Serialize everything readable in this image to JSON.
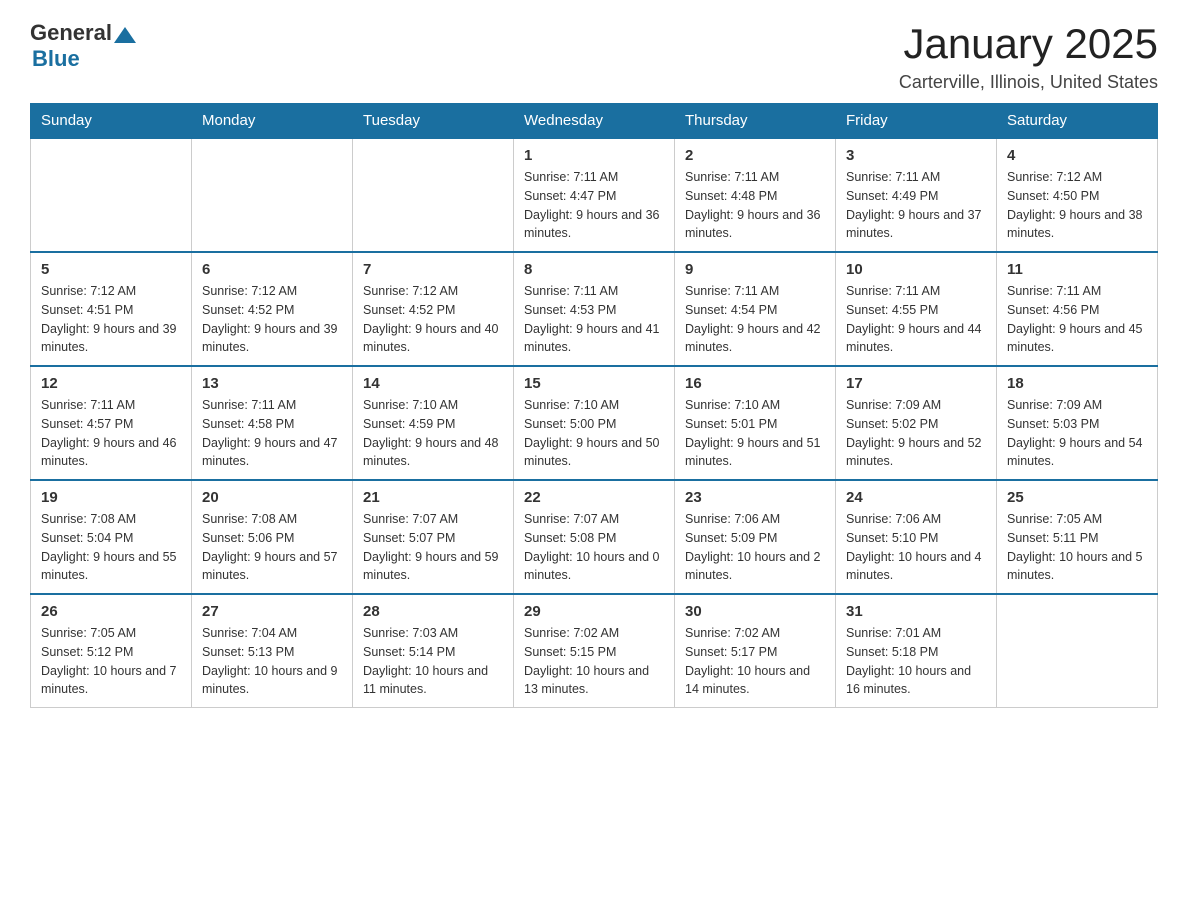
{
  "logo": {
    "text_general": "General",
    "triangle": "▲",
    "text_blue": "Blue"
  },
  "header": {
    "title": "January 2025",
    "subtitle": "Carterville, Illinois, United States"
  },
  "days_of_week": [
    "Sunday",
    "Monday",
    "Tuesday",
    "Wednesday",
    "Thursday",
    "Friday",
    "Saturday"
  ],
  "weeks": [
    [
      {
        "day": "",
        "info": ""
      },
      {
        "day": "",
        "info": ""
      },
      {
        "day": "",
        "info": ""
      },
      {
        "day": "1",
        "info": "Sunrise: 7:11 AM\nSunset: 4:47 PM\nDaylight: 9 hours and 36 minutes."
      },
      {
        "day": "2",
        "info": "Sunrise: 7:11 AM\nSunset: 4:48 PM\nDaylight: 9 hours and 36 minutes."
      },
      {
        "day": "3",
        "info": "Sunrise: 7:11 AM\nSunset: 4:49 PM\nDaylight: 9 hours and 37 minutes."
      },
      {
        "day": "4",
        "info": "Sunrise: 7:12 AM\nSunset: 4:50 PM\nDaylight: 9 hours and 38 minutes."
      }
    ],
    [
      {
        "day": "5",
        "info": "Sunrise: 7:12 AM\nSunset: 4:51 PM\nDaylight: 9 hours and 39 minutes."
      },
      {
        "day": "6",
        "info": "Sunrise: 7:12 AM\nSunset: 4:52 PM\nDaylight: 9 hours and 39 minutes."
      },
      {
        "day": "7",
        "info": "Sunrise: 7:12 AM\nSunset: 4:52 PM\nDaylight: 9 hours and 40 minutes."
      },
      {
        "day": "8",
        "info": "Sunrise: 7:11 AM\nSunset: 4:53 PM\nDaylight: 9 hours and 41 minutes."
      },
      {
        "day": "9",
        "info": "Sunrise: 7:11 AM\nSunset: 4:54 PM\nDaylight: 9 hours and 42 minutes."
      },
      {
        "day": "10",
        "info": "Sunrise: 7:11 AM\nSunset: 4:55 PM\nDaylight: 9 hours and 44 minutes."
      },
      {
        "day": "11",
        "info": "Sunrise: 7:11 AM\nSunset: 4:56 PM\nDaylight: 9 hours and 45 minutes."
      }
    ],
    [
      {
        "day": "12",
        "info": "Sunrise: 7:11 AM\nSunset: 4:57 PM\nDaylight: 9 hours and 46 minutes."
      },
      {
        "day": "13",
        "info": "Sunrise: 7:11 AM\nSunset: 4:58 PM\nDaylight: 9 hours and 47 minutes."
      },
      {
        "day": "14",
        "info": "Sunrise: 7:10 AM\nSunset: 4:59 PM\nDaylight: 9 hours and 48 minutes."
      },
      {
        "day": "15",
        "info": "Sunrise: 7:10 AM\nSunset: 5:00 PM\nDaylight: 9 hours and 50 minutes."
      },
      {
        "day": "16",
        "info": "Sunrise: 7:10 AM\nSunset: 5:01 PM\nDaylight: 9 hours and 51 minutes."
      },
      {
        "day": "17",
        "info": "Sunrise: 7:09 AM\nSunset: 5:02 PM\nDaylight: 9 hours and 52 minutes."
      },
      {
        "day": "18",
        "info": "Sunrise: 7:09 AM\nSunset: 5:03 PM\nDaylight: 9 hours and 54 minutes."
      }
    ],
    [
      {
        "day": "19",
        "info": "Sunrise: 7:08 AM\nSunset: 5:04 PM\nDaylight: 9 hours and 55 minutes."
      },
      {
        "day": "20",
        "info": "Sunrise: 7:08 AM\nSunset: 5:06 PM\nDaylight: 9 hours and 57 minutes."
      },
      {
        "day": "21",
        "info": "Sunrise: 7:07 AM\nSunset: 5:07 PM\nDaylight: 9 hours and 59 minutes."
      },
      {
        "day": "22",
        "info": "Sunrise: 7:07 AM\nSunset: 5:08 PM\nDaylight: 10 hours and 0 minutes."
      },
      {
        "day": "23",
        "info": "Sunrise: 7:06 AM\nSunset: 5:09 PM\nDaylight: 10 hours and 2 minutes."
      },
      {
        "day": "24",
        "info": "Sunrise: 7:06 AM\nSunset: 5:10 PM\nDaylight: 10 hours and 4 minutes."
      },
      {
        "day": "25",
        "info": "Sunrise: 7:05 AM\nSunset: 5:11 PM\nDaylight: 10 hours and 5 minutes."
      }
    ],
    [
      {
        "day": "26",
        "info": "Sunrise: 7:05 AM\nSunset: 5:12 PM\nDaylight: 10 hours and 7 minutes."
      },
      {
        "day": "27",
        "info": "Sunrise: 7:04 AM\nSunset: 5:13 PM\nDaylight: 10 hours and 9 minutes."
      },
      {
        "day": "28",
        "info": "Sunrise: 7:03 AM\nSunset: 5:14 PM\nDaylight: 10 hours and 11 minutes."
      },
      {
        "day": "29",
        "info": "Sunrise: 7:02 AM\nSunset: 5:15 PM\nDaylight: 10 hours and 13 minutes."
      },
      {
        "day": "30",
        "info": "Sunrise: 7:02 AM\nSunset: 5:17 PM\nDaylight: 10 hours and 14 minutes."
      },
      {
        "day": "31",
        "info": "Sunrise: 7:01 AM\nSunset: 5:18 PM\nDaylight: 10 hours and 16 minutes."
      },
      {
        "day": "",
        "info": ""
      }
    ]
  ]
}
